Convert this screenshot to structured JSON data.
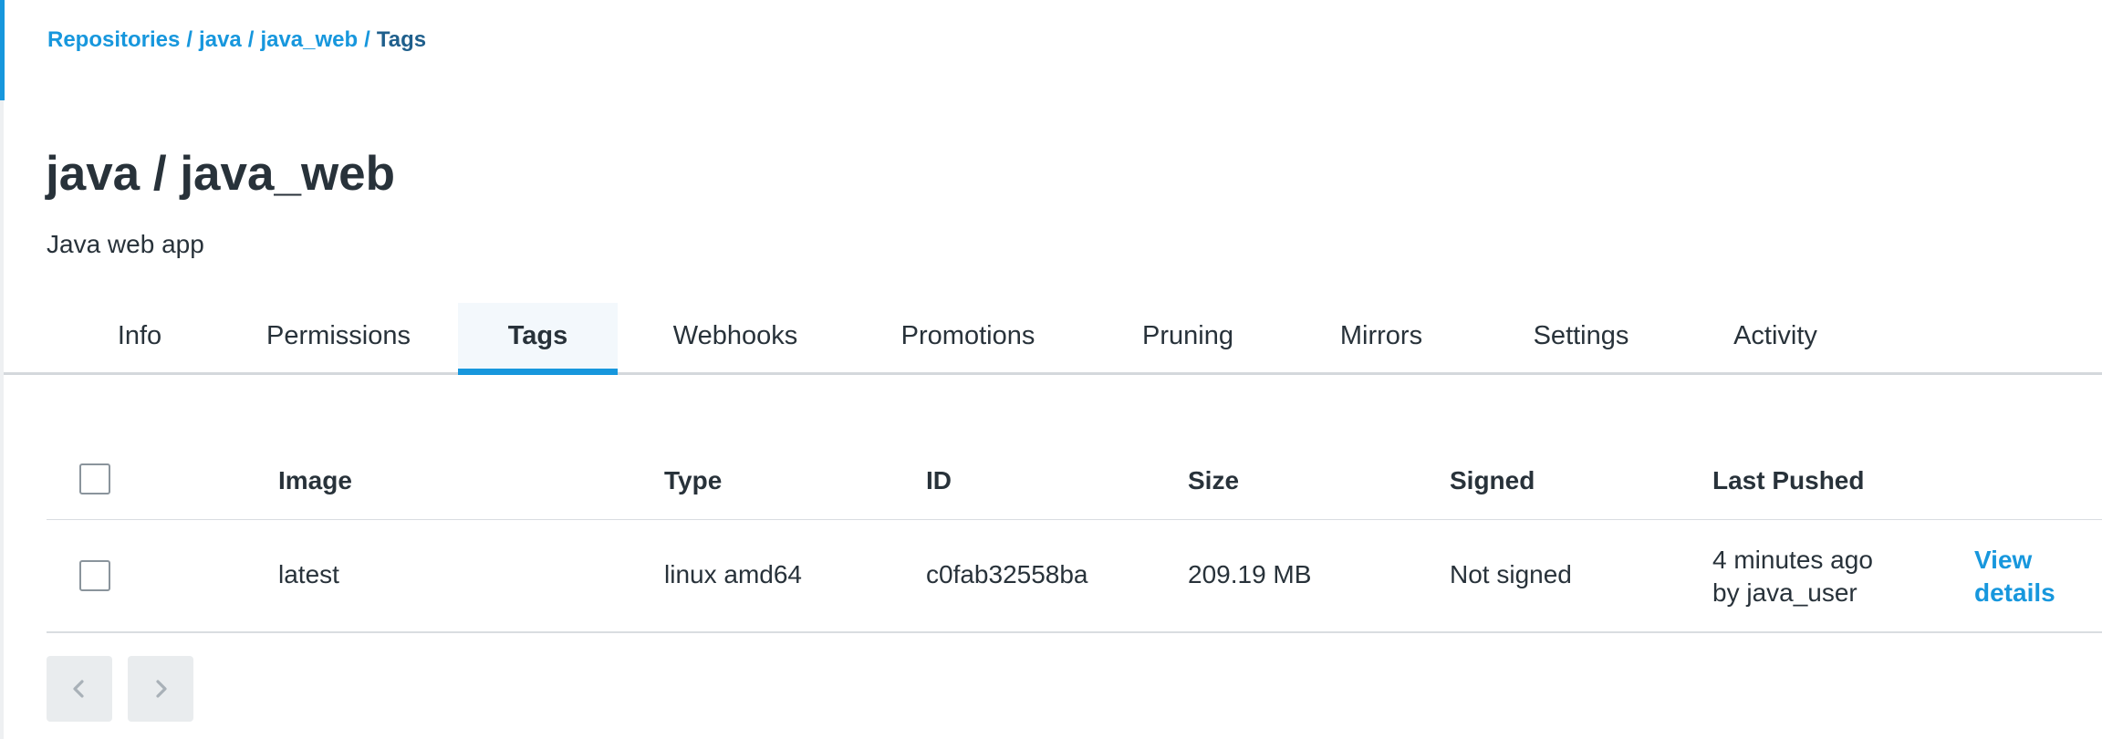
{
  "breadcrumb": {
    "items": [
      "Repositories",
      "java",
      "java_web"
    ],
    "separator": "/",
    "current": "Tags"
  },
  "header": {
    "title": "java / java_web",
    "description": "Java web app"
  },
  "tabs": [
    {
      "label": "Info"
    },
    {
      "label": "Permissions"
    },
    {
      "label": "Tags",
      "active": true
    },
    {
      "label": "Webhooks"
    },
    {
      "label": "Promotions"
    },
    {
      "label": "Pruning"
    },
    {
      "label": "Mirrors"
    },
    {
      "label": "Settings"
    },
    {
      "label": "Activity"
    }
  ],
  "table": {
    "columns": [
      "Image",
      "Type",
      "ID",
      "Size",
      "Signed",
      "Last Pushed"
    ],
    "rows": [
      {
        "image": "latest",
        "type": "linux amd64",
        "id": "c0fab32558ba",
        "size": "209.19 MB",
        "signed": "Not signed",
        "last_pushed_line1": "4 minutes ago",
        "last_pushed_line2": "by java_user",
        "action_line1": "View",
        "action_line2": "details"
      }
    ]
  },
  "pagination": {
    "prev_icon": "chevron-left-icon",
    "next_icon": "chevron-right-icon"
  },
  "colors": {
    "accent": "#1797dd",
    "text": "#28323a",
    "active_tab_bg": "#f3f8fc",
    "pager_bg": "#e9ecee"
  }
}
